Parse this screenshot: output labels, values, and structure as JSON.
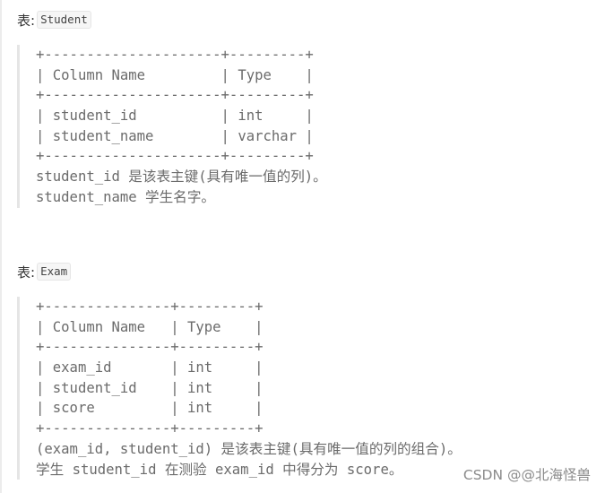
{
  "sections": [
    {
      "label_prefix": "表:",
      "table_name": "Student",
      "lines": [
        "+---------------------+---------+",
        "| Column Name         | Type    |",
        "+---------------------+---------+",
        "| student_id          | int     |",
        "| student_name        | varchar |",
        "+---------------------+---------+",
        "student_id 是该表主键(具有唯一值的列)。",
        "student_name 学生名字。"
      ]
    },
    {
      "label_prefix": "表:",
      "table_name": "Exam",
      "lines": [
        "+---------------+---------+",
        "| Column Name   | Type    |",
        "+---------------+---------+",
        "| exam_id       | int     |",
        "| student_id    | int     |",
        "| score         | int     |",
        "+---------------+---------+",
        "(exam_id, student_id) 是该表主键(具有唯一值的列的组合)。",
        "学生 student_id 在测验 exam_id 中得分为 score。"
      ]
    }
  ],
  "watermark": "CSDN @@北海怪兽"
}
